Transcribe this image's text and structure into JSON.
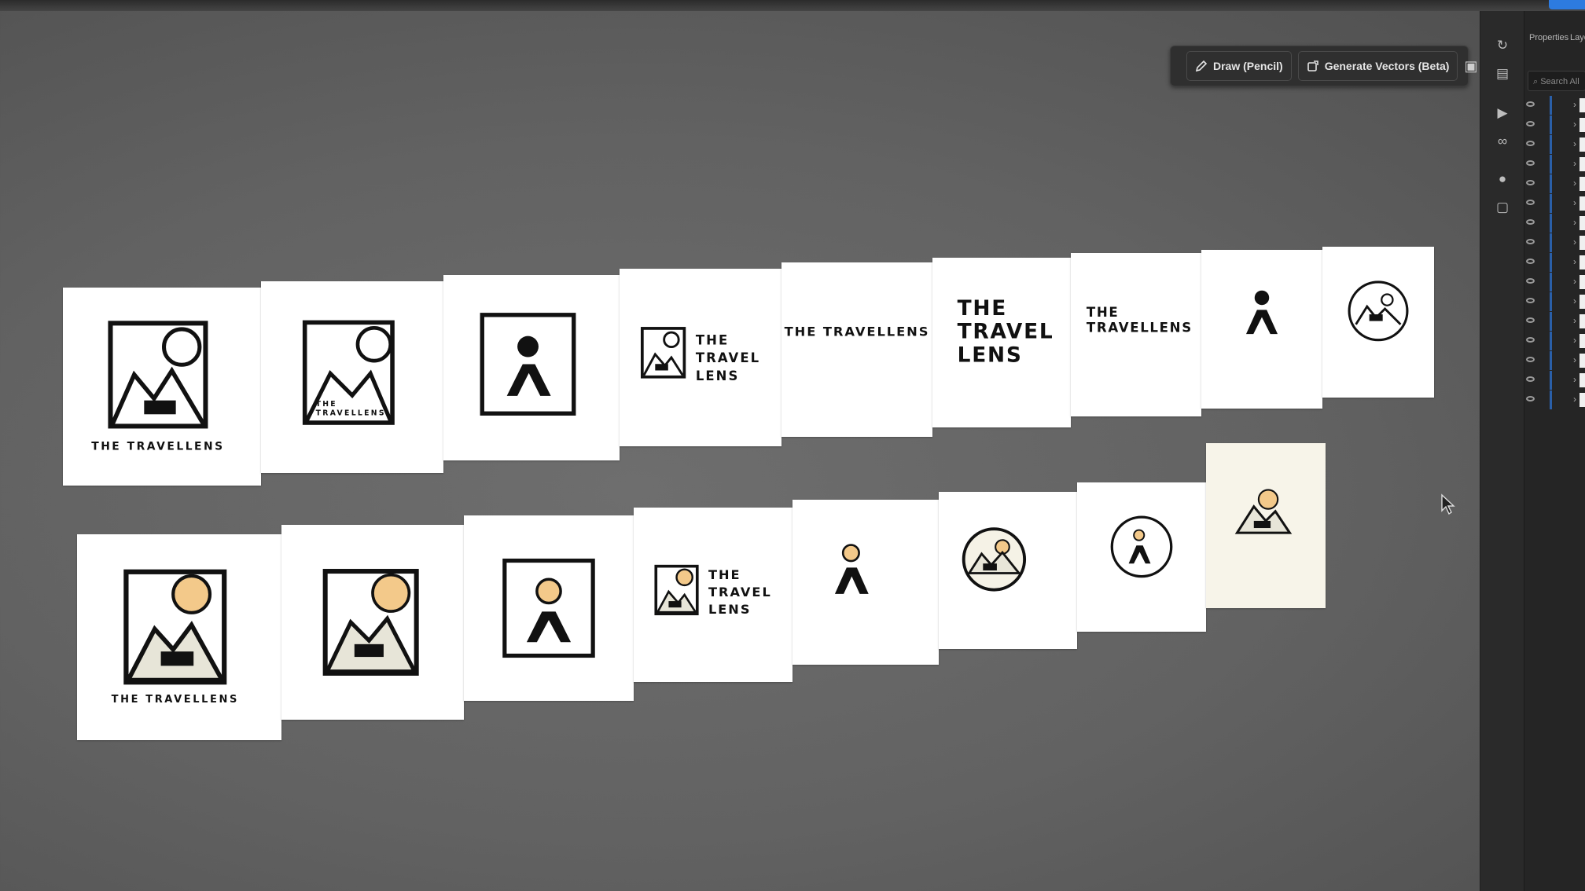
{
  "toolbar": {
    "draw_label": "Draw (Pencil)",
    "generate_label": "Generate Vectors (Beta)"
  },
  "panel": {
    "tab_properties": "Properties",
    "tab_layers": "Laye",
    "search_placeholder": "Search All"
  },
  "artboards": {
    "row1": [
      {
        "caption": "THE TRAVELLENS"
      },
      {
        "caption_line1": "THE",
        "caption_line2": "TRAVELLENS"
      },
      {},
      {
        "line1": "THE",
        "line2": "TRAVEL",
        "line3": "LENS"
      },
      {
        "text": "THE TRAVELLENS"
      },
      {
        "line1": "THE",
        "line2": "TRAVEL",
        "line3": "LENS"
      },
      {
        "line1": "THE",
        "line2": "TRAVELLENS"
      },
      {},
      {}
    ],
    "row2": [
      {
        "caption": "THE TRAVELLENS"
      },
      {},
      {},
      {
        "line1": "THE",
        "line2": "TRAVEL",
        "line3": "LENS"
      },
      {},
      {},
      {},
      {}
    ]
  },
  "colors": {
    "sun": "#f3c98a",
    "ink": "#111111",
    "mountain_fill": "#e7e5d8",
    "card": "#ffffff",
    "card_cream": "#f7f4e9"
  }
}
